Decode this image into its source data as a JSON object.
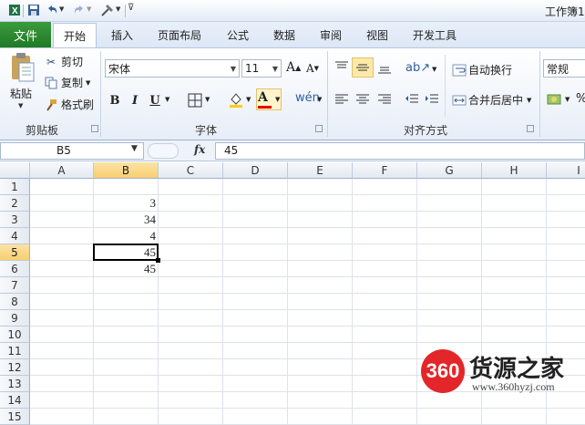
{
  "window": {
    "title": "工作簿1"
  },
  "quick_access": {
    "save_icon": "save-icon",
    "undo_icon": "undo-icon",
    "redo_icon": "redo-icon",
    "customize_icon": "customize-icon"
  },
  "tabs": {
    "file": "文件",
    "home": "开始",
    "insert": "插入",
    "page_layout": "页面布局",
    "formulas": "公式",
    "data": "数据",
    "review": "审阅",
    "view": "视图",
    "developer": "开发工具"
  },
  "ribbon": {
    "clipboard": {
      "paste": "粘贴",
      "cut": "剪切",
      "copy": "复制",
      "format_painter": "格式刷",
      "label": "剪贴板"
    },
    "font": {
      "name": "宋体",
      "size": "11",
      "bold": "B",
      "italic": "I",
      "underline": "U",
      "label": "字体"
    },
    "alignment": {
      "wrap_text": "自动换行",
      "merge_center": "合并后居中",
      "label": "对齐方式"
    },
    "number": {
      "format": "常规"
    }
  },
  "formula_bar": {
    "name_box": "B5",
    "fx": "fx",
    "value": "45"
  },
  "sheet": {
    "columns": [
      "A",
      "B",
      "C",
      "D",
      "E",
      "F",
      "G",
      "H",
      "I"
    ],
    "rows": [
      "1",
      "2",
      "3",
      "4",
      "5",
      "6",
      "7",
      "8",
      "9",
      "10",
      "11",
      "12",
      "13",
      "14",
      "15"
    ],
    "cells": {
      "B2": "3",
      "B3": "34",
      "B4": "4",
      "B5": "45",
      "B6": "45"
    },
    "active_cell": "B5"
  },
  "watermark": {
    "logo": "360",
    "title": "货源之家",
    "url": "www.360hyzj.com"
  },
  "colors": {
    "file_tab": "#2a8a2e",
    "selected_header": "#f8cf6e",
    "watermark_red": "#e3262a"
  }
}
